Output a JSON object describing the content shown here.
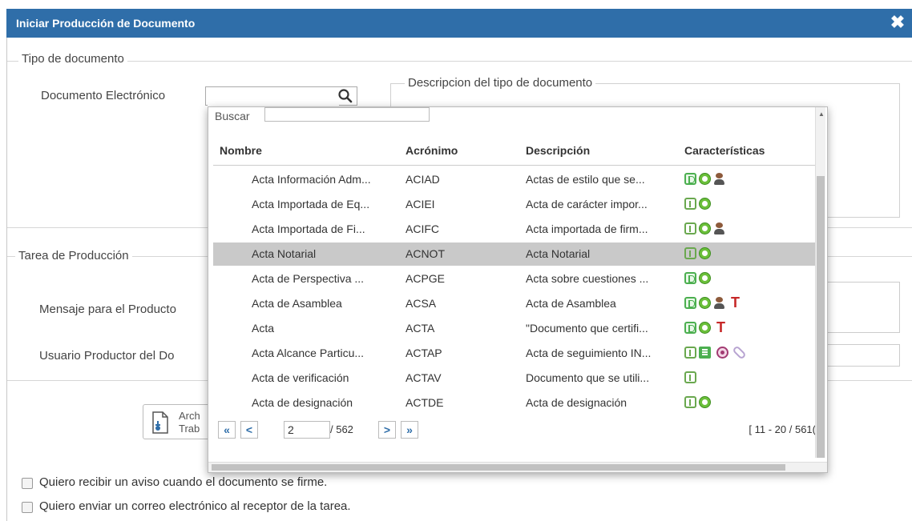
{
  "dialog": {
    "title": "Iniciar Producción de Documento",
    "close_icon": "close-icon"
  },
  "section_tipo": {
    "legend": "Tipo de documento",
    "doc_label": "Documento Electrónico",
    "search_value": "",
    "desc_legend": "Descripcion del tipo de documento"
  },
  "section_tarea": {
    "legend": "Tarea de Producción",
    "mensaje_label": "Mensaje para el Producto",
    "usuario_label": "Usuario Productor del Do"
  },
  "archivo_button": {
    "line1": "Arch",
    "line2": "Trab"
  },
  "checkboxes": [
    {
      "label": "Quiero recibir un aviso cuando el documento se firme.",
      "checked": false
    },
    {
      "label": "Quiero enviar un correo electrónico al receptor de la tarea.",
      "checked": false
    }
  ],
  "popup": {
    "search_label": "Buscar",
    "search_value": "",
    "columns": [
      "Nombre",
      "Acrónimo",
      "Descripción",
      "Características"
    ],
    "rows": [
      {
        "nombre": "Acta Información Adm...",
        "acronimo": "ACIAD",
        "descripcion": "Actas de estilo que se...",
        "icons": [
          "D",
          "O",
          "P"
        ]
      },
      {
        "nombre": "Acta Importada de Eq...",
        "acronimo": "ACIEI",
        "descripcion": "Acta de carácter impor...",
        "icons": [
          "I",
          "O"
        ]
      },
      {
        "nombre": "Acta Importada de Fi...",
        "acronimo": "ACIFC",
        "descripcion": "Acta importada de firm...",
        "icons": [
          "I",
          "O",
          "P"
        ]
      },
      {
        "nombre": "Acta Notarial",
        "acronimo": "ACNOT",
        "descripcion": "Acta Notarial",
        "icons": [
          "I",
          "O"
        ],
        "selected": true
      },
      {
        "nombre": "Acta de Perspectiva ...",
        "acronimo": "ACPGE",
        "descripcion": "Acta sobre cuestiones ...",
        "icons": [
          "D",
          "O"
        ]
      },
      {
        "nombre": "Acta de Asamblea",
        "acronimo": "ACSA",
        "descripcion": "Acta de Asamblea",
        "icons": [
          "D",
          "O",
          "P",
          "T"
        ]
      },
      {
        "nombre": "Acta",
        "acronimo": "ACTA",
        "descripcion": "\"Documento que certifi...",
        "icons": [
          "D",
          "O",
          "T"
        ]
      },
      {
        "nombre": "Acta Alcance Particu...",
        "acronimo": "ACTAP",
        "descripcion": "Acta de seguimiento IN...",
        "icons": [
          "I",
          "E",
          "R",
          "C"
        ]
      },
      {
        "nombre": "Acta de verificación",
        "acronimo": "ACTAV",
        "descripcion": "Documento que se utili...",
        "icons": [
          "I"
        ]
      },
      {
        "nombre": "Acta de designación",
        "acronimo": "ACTDE",
        "descripcion": "Acta de designación",
        "icons": [
          "I",
          "O"
        ]
      }
    ],
    "pager": {
      "first": "«",
      "prev": "<",
      "page": "2",
      "total": "/ 562",
      "next": ">",
      "last": "»",
      "range": "[ 11 - 20 / 561("
    }
  },
  "icon_names": {
    "D": "document-green-icon",
    "O": "signature-green-icon",
    "P": "person-icon",
    "I": "info-doc-icon",
    "T": "t-red-icon",
    "E": "list-doc-icon",
    "R": "seal-icon",
    "C": "paperclip-icon"
  }
}
